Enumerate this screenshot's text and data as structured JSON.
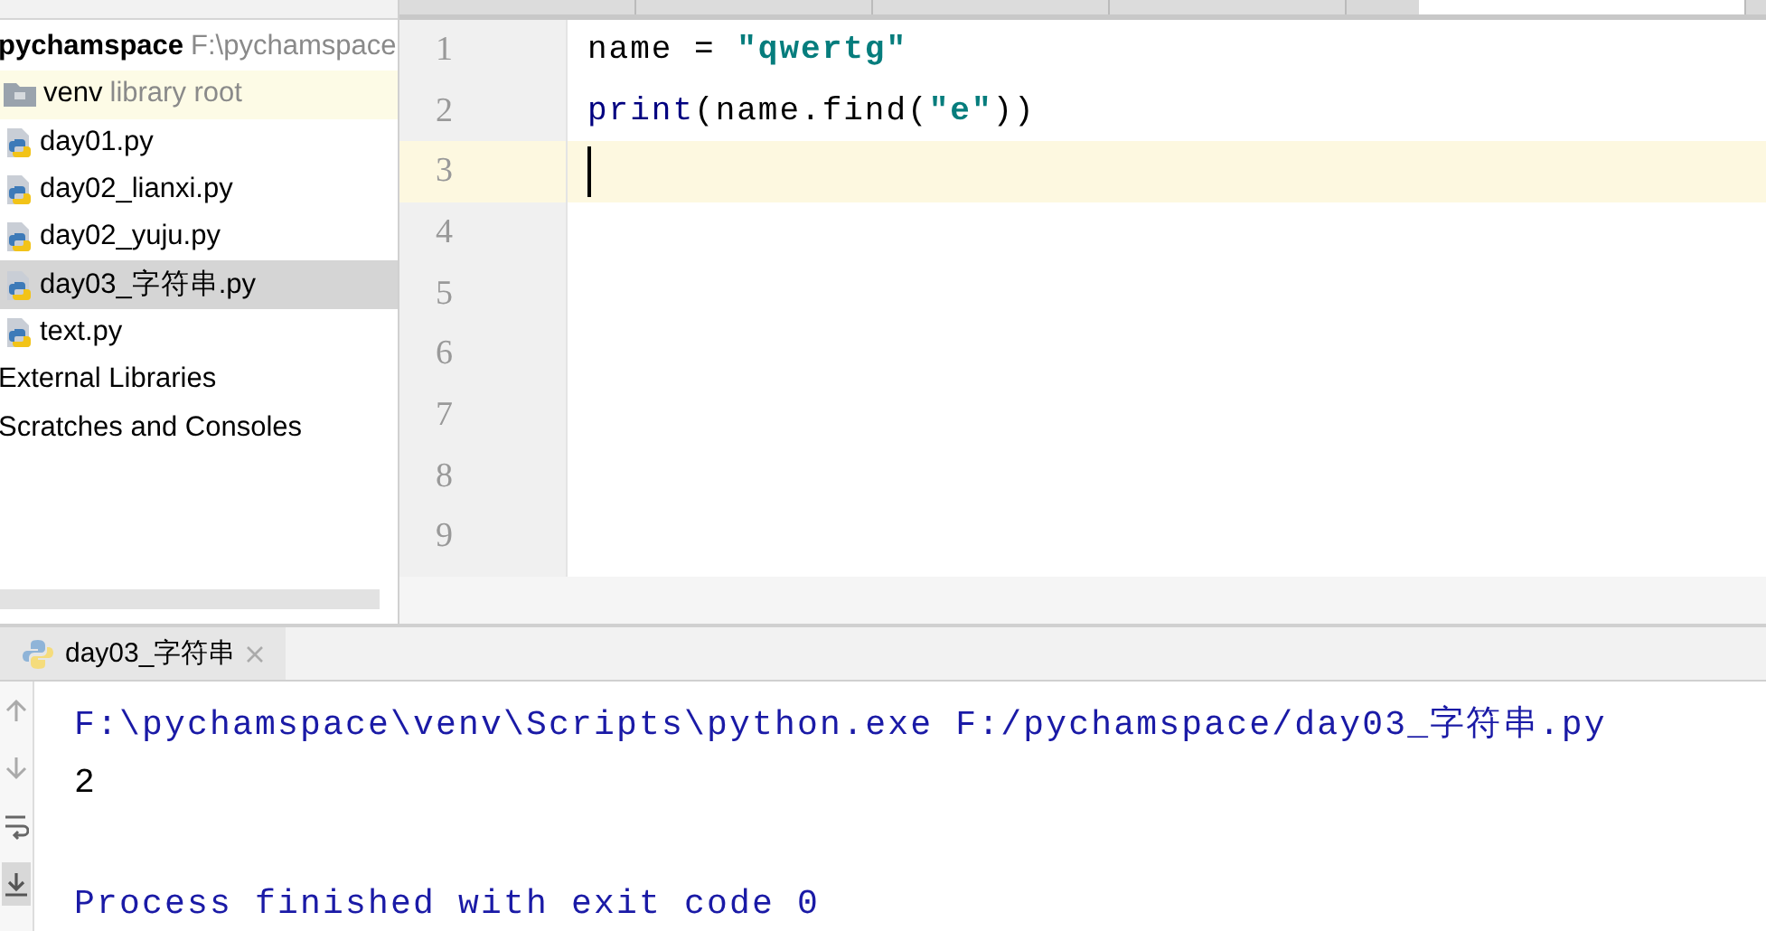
{
  "editor_tabs": [
    {
      "selected": false
    },
    {
      "selected": false
    },
    {
      "selected": false
    },
    {
      "selected": false
    },
    {
      "selected": true
    }
  ],
  "project_tree": [
    {
      "kind": "project",
      "label": "pychamspace",
      "hint": "F:\\pychamspace",
      "children": [
        {
          "kind": "folder",
          "label": "venv",
          "hint": "library root",
          "highlighted": true,
          "selected": false
        },
        {
          "kind": "python",
          "label": "day01.py",
          "selected": false
        },
        {
          "kind": "python",
          "label": "day02_lianxi.py",
          "selected": false
        },
        {
          "kind": "python",
          "label": "day02_yuju.py",
          "selected": false
        },
        {
          "kind": "python",
          "label": "day03_字符串.py",
          "selected": true
        },
        {
          "kind": "python",
          "label": "text.py",
          "selected": false
        }
      ]
    },
    {
      "kind": "library",
      "label": "External Libraries"
    },
    {
      "kind": "scratch",
      "label": "Scratches and Consoles"
    }
  ],
  "editor": {
    "lines": [
      {
        "number": "1",
        "current": false,
        "tokens": [
          {
            "kind": "plain",
            "text": "name = "
          },
          {
            "kind": "string",
            "text": "\"qwertg\""
          }
        ]
      },
      {
        "number": "2",
        "current": false,
        "tokens": [
          {
            "kind": "builtin",
            "text": "print"
          },
          {
            "kind": "plain",
            "text": "(name.find("
          },
          {
            "kind": "string",
            "text": "\"e\""
          },
          {
            "kind": "plain",
            "text": "))"
          }
        ]
      },
      {
        "number": "3",
        "current": true
      },
      {
        "number": "4",
        "current": false
      },
      {
        "number": "5",
        "current": false
      },
      {
        "number": "6",
        "current": false
      },
      {
        "number": "7",
        "current": false
      },
      {
        "number": "8",
        "current": false
      },
      {
        "number": "9",
        "current": false
      }
    ]
  },
  "run_panel": {
    "tab": {
      "label": "day03_字符串",
      "selected": true
    },
    "toolbar": [
      {
        "kind": "up",
        "on": false
      },
      {
        "kind": "down",
        "on": false
      },
      {
        "kind": "wrap",
        "on": false
      },
      {
        "kind": "scroll-end",
        "on": true
      }
    ],
    "output": [
      {
        "kind": "command",
        "text": "F:\\pychamspace\\venv\\Scripts\\python.exe F:/pychamspace/day03_字符串.py"
      },
      {
        "kind": "stdout",
        "text": "2"
      },
      {
        "kind": "exit",
        "text": "Process finished with exit code 0"
      }
    ]
  }
}
